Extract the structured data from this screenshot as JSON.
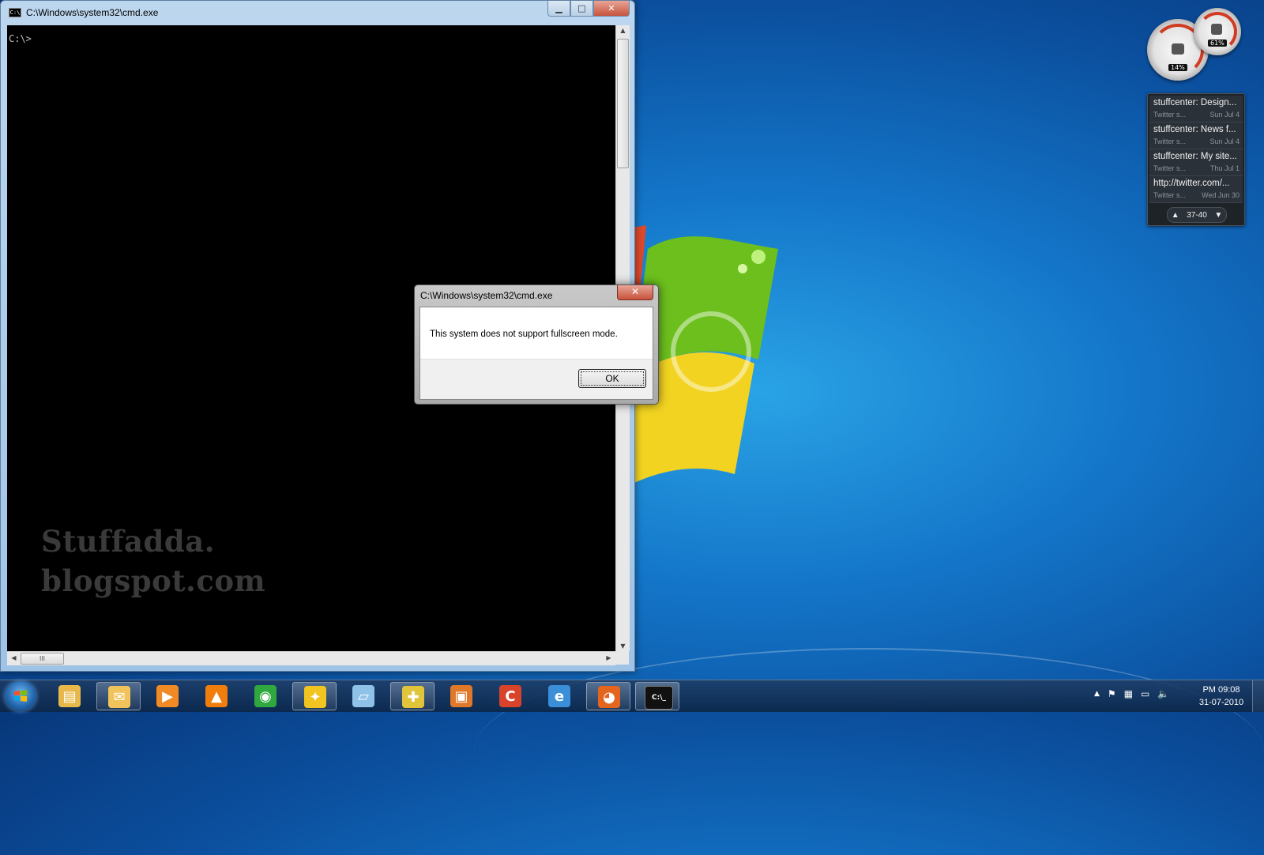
{
  "watermark": {
    "line1": "Stuffadda.",
    "line2": "blogspot.com"
  },
  "cmd_window": {
    "title": "C:\\Windows\\system32\\cmd.exe",
    "icon_label": "C:\\",
    "prompt": "C:\\>",
    "controls": {
      "minimize": "▁",
      "maximize": "□",
      "close": "✕"
    }
  },
  "dialog": {
    "title": "C:\\Windows\\system32\\cmd.exe",
    "close": "✕",
    "message": "This system does not support fullscreen mode.",
    "ok_label": "OK"
  },
  "gadgets": {
    "cpu_meter": {
      "cpu_label": "14%",
      "memory_label": "61%",
      "accent": "#d23b24"
    },
    "twitter_feed": {
      "items": [
        {
          "title": "stuffcenter: Design...",
          "source": "Twitter  s...",
          "date": "Sun Jul 4"
        },
        {
          "title": "stuffcenter: News f...",
          "source": "Twitter  s...",
          "date": "Sun Jul 4"
        },
        {
          "title": "stuffcenter: My site...",
          "source": "Twitter  s...",
          "date": "Thu Jul 1"
        },
        {
          "title": "http://twitter.com/...",
          "source": "Twitter  s...",
          "date": "Wed Jun 30"
        }
      ],
      "pager": {
        "up": "▲",
        "range": "37-40",
        "down": "▼"
      }
    }
  },
  "taskbar": {
    "start_icon": "windows-logo",
    "apps": [
      {
        "name": "explorer",
        "glyph": "▤",
        "color": "#e8b94a",
        "state": "pinned"
      },
      {
        "name": "outlook",
        "glyph": "✉",
        "color": "#f1c35b",
        "state": "open"
      },
      {
        "name": "media-player",
        "glyph": "▶",
        "color": "#f08a24",
        "state": "pinned"
      },
      {
        "name": "vlc",
        "glyph": "▲",
        "color": "#f07d0c",
        "state": "pinned"
      },
      {
        "name": "app-green",
        "glyph": "◉",
        "color": "#2fa83f",
        "state": "pinned"
      },
      {
        "name": "app-yellow",
        "glyph": "✦",
        "color": "#f2c420",
        "state": "open"
      },
      {
        "name": "app-book",
        "glyph": "▱",
        "color": "#8fc2e8",
        "state": "pinned"
      },
      {
        "name": "app-plus",
        "glyph": "✚",
        "color": "#e0c43a",
        "state": "open"
      },
      {
        "name": "virtual-pc",
        "glyph": "▣",
        "color": "#e0782a",
        "state": "pinned"
      },
      {
        "name": "ccleaner",
        "glyph": "C",
        "color": "#d9432b",
        "state": "pinned"
      },
      {
        "name": "internet-explorer",
        "glyph": "e",
        "color": "#3a8fd8",
        "state": "pinned"
      },
      {
        "name": "firefox",
        "glyph": "◕",
        "color": "#e4651e",
        "state": "open"
      },
      {
        "name": "cmd",
        "glyph": "C:\\_",
        "color": "#111111",
        "state": "open"
      }
    ],
    "tray": {
      "expand": "▲",
      "flag": "⚑",
      "network": "▦",
      "display": "▭",
      "volume": "🔈"
    },
    "clock": {
      "time": "PM 09:08",
      "date": "31-07-2010"
    }
  }
}
